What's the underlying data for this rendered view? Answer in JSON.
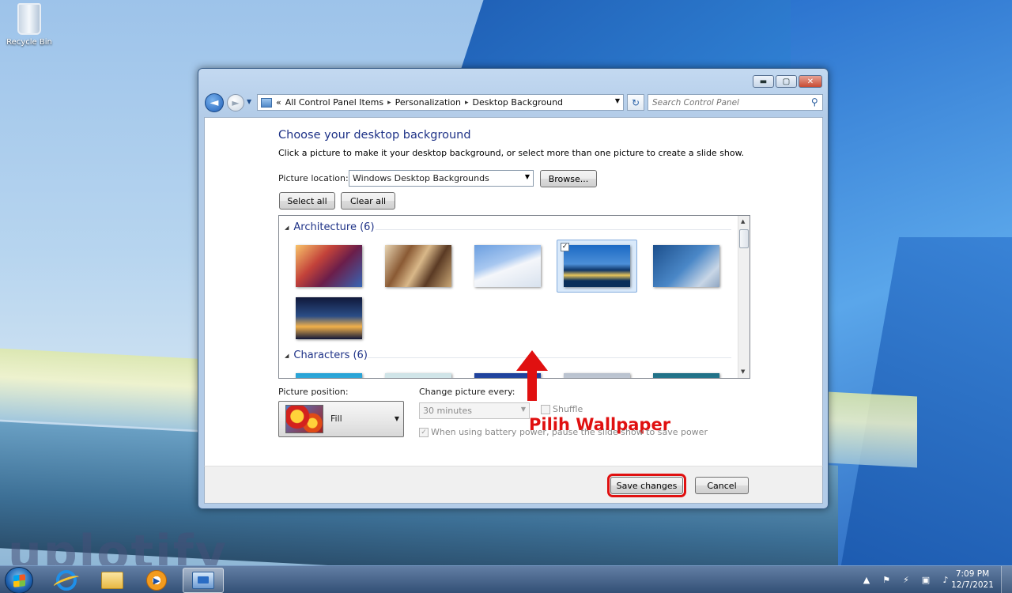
{
  "desktop": {
    "recycle_bin_label": "Recycle Bin",
    "watermark": "uplotify"
  },
  "window": {
    "controls": {
      "minimize": "▬",
      "maximize": "▢",
      "close": "✕"
    },
    "nav": {
      "back": "◄",
      "forward": "►",
      "breadcrumb": {
        "overflow": "«",
        "items": [
          "All Control Panel Items",
          "Personalization",
          "Desktop Background"
        ],
        "separator": "▸"
      },
      "refresh": "↻",
      "search_placeholder": "Search Control Panel"
    },
    "main": {
      "heading": "Choose your desktop background",
      "subtext": "Click a picture to make it your desktop background, or select more than one picture to create a slide show.",
      "picture_location_label": "Picture location:",
      "picture_location_value": "Windows Desktop Backgrounds",
      "browse_label": "Browse...",
      "select_all_label": "Select all",
      "clear_all_label": "Clear all",
      "gallery": {
        "groups": [
          {
            "name": "Architecture (6)",
            "thumbnails": 6,
            "selected_index": 3
          },
          {
            "name": "Characters (6)",
            "thumbnails": 6
          }
        ]
      },
      "annotation": "Pilih Wallpaper",
      "picture_position_label": "Picture position:",
      "picture_position_value": "Fill",
      "change_every_label": "Change picture every:",
      "change_every_value": "30 minutes",
      "shuffle_label": "Shuffle",
      "shuffle_checked": false,
      "battery_label": "When using battery power, pause the slide show to save power",
      "battery_checked": true
    },
    "footer": {
      "save_label": "Save changes",
      "cancel_label": "Cancel"
    }
  },
  "taskbar": {
    "items": [
      "start-orb",
      "internet-explorer-icon",
      "windows-explorer-icon",
      "media-player-icon",
      "control-panel-icon"
    ],
    "active_item": "control-panel-icon",
    "tray": {
      "show_hidden": "▲"
    },
    "clock": {
      "time": "7:09 PM",
      "date": "12/7/2021"
    }
  },
  "colors": {
    "accent_heading": "#1e3287",
    "annotation_red": "#e01010",
    "selection_bg": "#d9e9fa"
  }
}
